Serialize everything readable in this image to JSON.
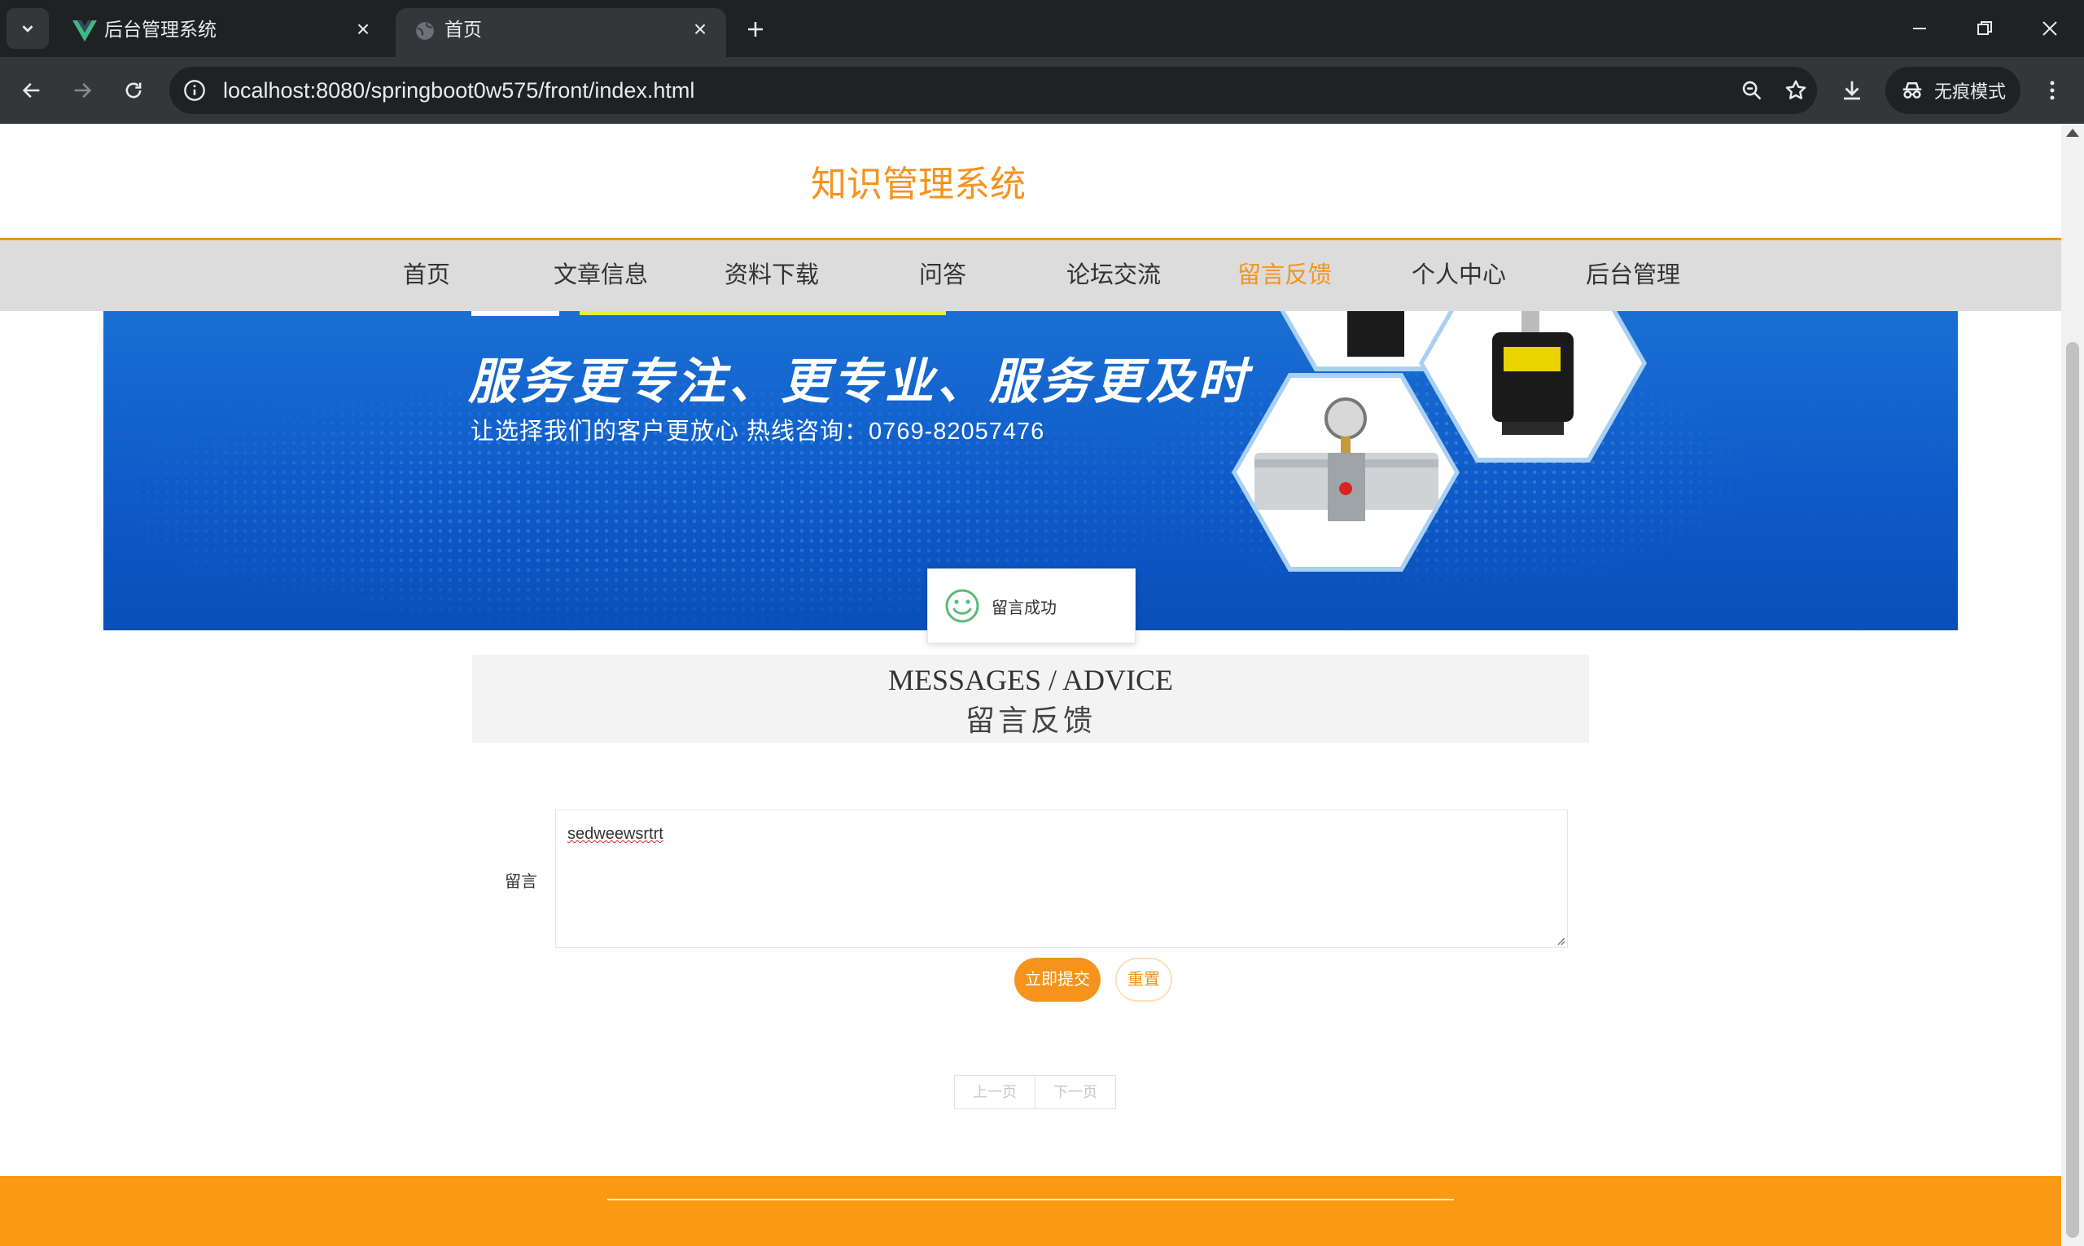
{
  "browser": {
    "tabs": [
      {
        "title": "后台管理系统",
        "icon": "vue-logo-icon",
        "active": false
      },
      {
        "title": "首页",
        "icon": "globe-icon",
        "active": true
      }
    ],
    "url_host": "localhost",
    "url_rest": ":8080/springboot0w575/front/index.html",
    "incognito_label": "无痕模式"
  },
  "site": {
    "title": "知识管理系统",
    "nav": [
      {
        "label": "首页",
        "active": false
      },
      {
        "label": "文章信息",
        "active": false
      },
      {
        "label": "资料下载",
        "active": false
      },
      {
        "label": "问答",
        "active": false
      },
      {
        "label": "论坛交流",
        "active": false
      },
      {
        "label": "留言反馈",
        "active": true
      },
      {
        "label": "个人中心",
        "active": false
      },
      {
        "label": "后台管理",
        "active": false
      }
    ],
    "accent_color": "#f5931d"
  },
  "banner": {
    "headline": "服务更专注、更专业、服务更及时",
    "subline": "让选择我们的客户更放心   热线咨询：0769-82057476"
  },
  "toast": {
    "message": "留言成功",
    "icon": "smile-icon"
  },
  "section": {
    "title_en": "MESSAGES / ADVICE",
    "title_cn": "留言反馈"
  },
  "form": {
    "label": "留言",
    "value": "sedweewsrtrt",
    "submit_label": "立即提交",
    "reset_label": "重置"
  },
  "pager": {
    "prev": "上一页",
    "next": "下一页"
  }
}
